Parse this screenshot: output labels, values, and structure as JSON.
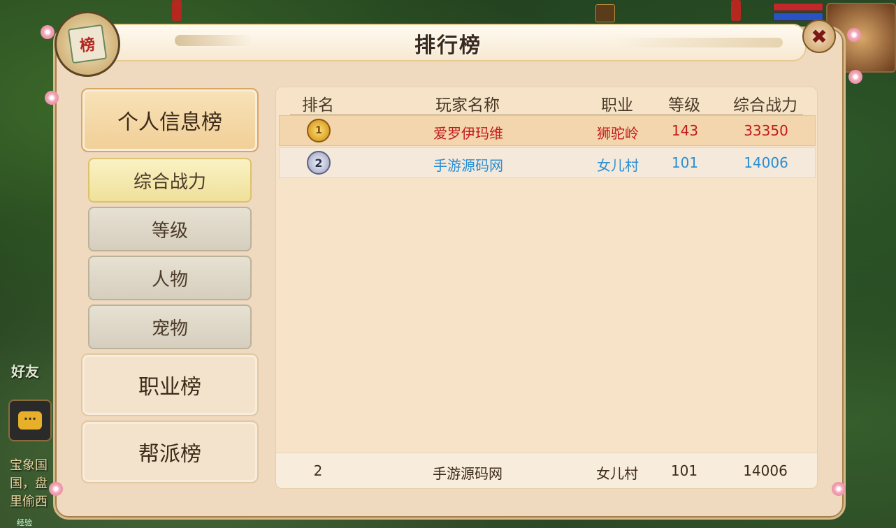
{
  "window": {
    "title": "排行榜",
    "badge_char": "榜",
    "close_glyph": "✖"
  },
  "background": {
    "friend_label": "好友",
    "chat_bubble": "···",
    "chat_lines": [
      "宝象国",
      "国，盘",
      "里偷西"
    ],
    "exp_label": "经验"
  },
  "nav": {
    "personal": "个人信息榜",
    "sub": [
      "综合战力",
      "等级",
      "人物",
      "宠物"
    ],
    "profession": "职业榜",
    "guild": "帮派榜"
  },
  "table": {
    "headers": [
      "排名",
      "玩家名称",
      "职业",
      "等级",
      "综合战力"
    ],
    "rows": [
      {
        "rank": "1",
        "name": "爱罗伊玛维",
        "job": "狮驼岭",
        "level": "143",
        "power": "33350"
      },
      {
        "rank": "2",
        "name": "手游源码网",
        "job": "女儿村",
        "level": "101",
        "power": "14006"
      }
    ],
    "self": {
      "rank": "2",
      "name": "手游源码网",
      "job": "女儿村",
      "level": "101",
      "power": "14006"
    }
  },
  "colors": {
    "rank1": "#c21a1a",
    "rank2": "#2a8fd2",
    "dialog_bg": "#efd9bf"
  }
}
